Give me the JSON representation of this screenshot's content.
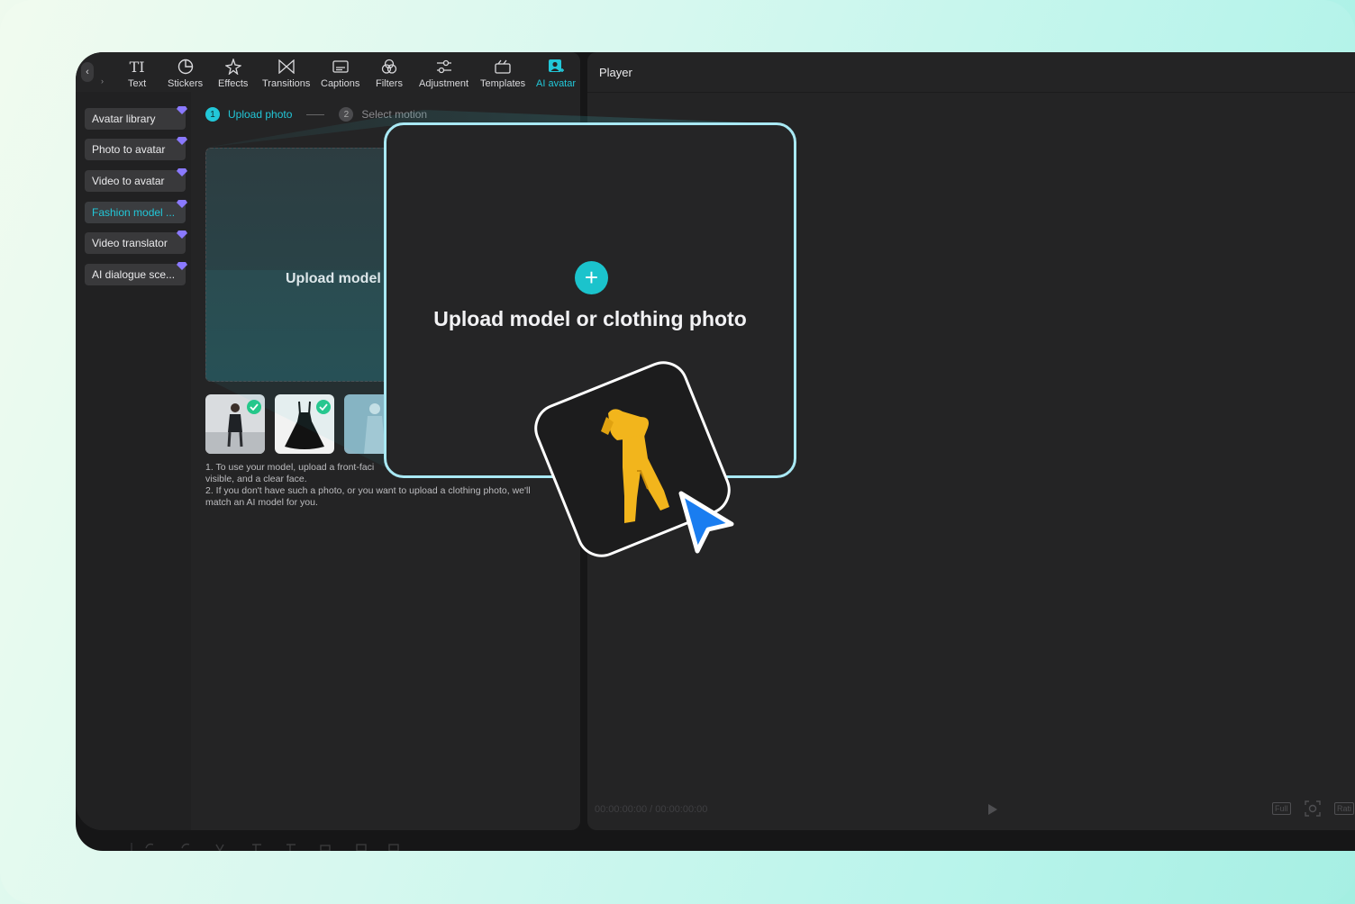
{
  "toolbar": {
    "tools": [
      {
        "id": "text",
        "label": "Text",
        "icon": "text-icon"
      },
      {
        "id": "stickers",
        "label": "Stickers",
        "icon": "sticker-icon"
      },
      {
        "id": "effects",
        "label": "Effects",
        "icon": "sparkle-icon"
      },
      {
        "id": "transitions",
        "label": "Transitions",
        "icon": "transition-icon"
      },
      {
        "id": "captions",
        "label": "Captions",
        "icon": "captions-icon"
      },
      {
        "id": "filters",
        "label": "Filters",
        "icon": "filters-icon"
      },
      {
        "id": "adjustment",
        "label": "Adjustment",
        "icon": "sliders-icon"
      },
      {
        "id": "templates",
        "label": "Templates",
        "icon": "templates-icon"
      },
      {
        "id": "ai-avatar",
        "label": "AI avatar",
        "icon": "avatar-icon",
        "active": true
      }
    ]
  },
  "sidebar": {
    "items": [
      {
        "label": "Avatar library"
      },
      {
        "label": "Photo to avatar"
      },
      {
        "label": "Video to avatar"
      },
      {
        "label": "Fashion model ...",
        "active": true
      },
      {
        "label": "Video translator"
      },
      {
        "label": "AI dialogue sce..."
      }
    ],
    "premium_icon": "diamond-icon"
  },
  "steps": {
    "step1_num": "1",
    "step1_label": "Upload photo",
    "step2_num": "2",
    "step2_label": "Select motion"
  },
  "upload": {
    "drop_text": "Upload model o",
    "hint_line1": "1. To use your model, upload a front-faci",
    "hint_line2": "visible, and a clear face.",
    "hint_line3": "2. If you don't have such a photo, or you want to upload a clothing photo, we'll",
    "hint_line4": "match an AI model for you."
  },
  "player": {
    "title": "Player",
    "time": "00:00:00:00 / 00:00:00:00",
    "full_label": "Full",
    "ratio_label": "Rati"
  },
  "popup": {
    "plus": "+",
    "text": "Upload model or clothing photo"
  },
  "colors": {
    "accent": "#22c7d8",
    "popup_border": "#a9e9f4",
    "cursor": "#1a7df0",
    "clothing": "#f2b51c"
  }
}
